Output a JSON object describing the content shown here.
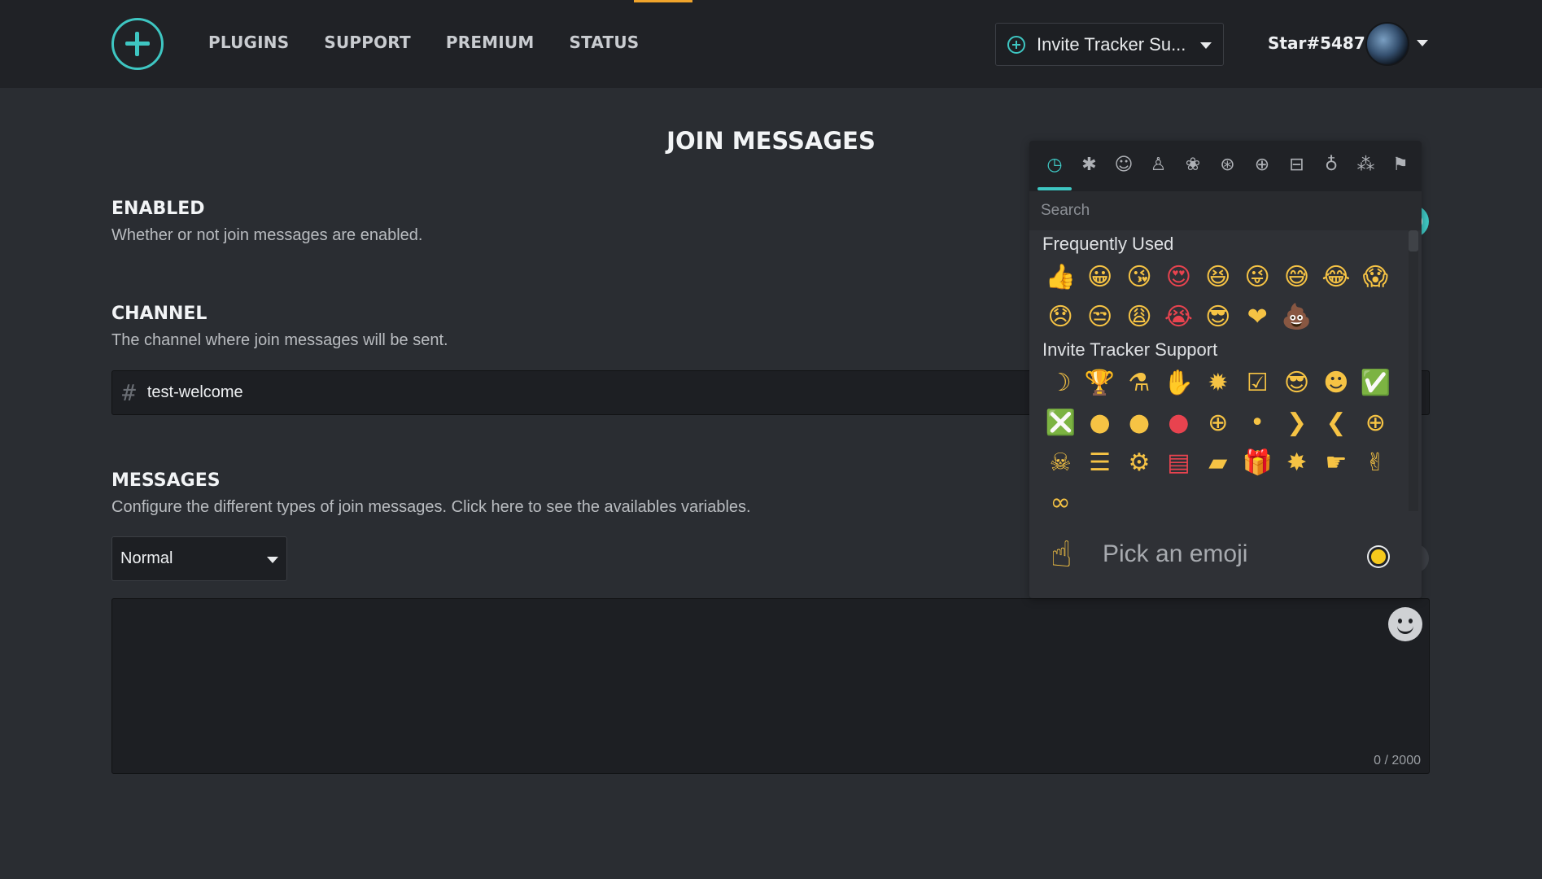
{
  "navbar": {
    "links": [
      "PLUGINS",
      "SUPPORT",
      "PREMIUM",
      "STATUS"
    ],
    "server_name": "Invite Tracker Su...",
    "user_name": "Star#5487",
    "accent_color": "#3ec6c2",
    "highlight_color": "#f0a42b"
  },
  "page": {
    "title": "JOIN MESSAGES"
  },
  "enabled": {
    "title": "ENABLED",
    "description": "Whether or not join messages are enabled."
  },
  "channel": {
    "title": "CHANNEL",
    "description": "The channel where join messages will be sent.",
    "hash": "#",
    "value": "test-welcome"
  },
  "messages": {
    "title": "MESSAGES",
    "description": "Configure the different types of join messages. Click here to see the availables variables.",
    "type_selected": "Normal",
    "char_count": "0 / 2000"
  },
  "emoji_picker": {
    "tabs": [
      {
        "name": "recent-icon",
        "glyph": "◷"
      },
      {
        "name": "custom-icon",
        "glyph": "✱"
      },
      {
        "name": "smileys-icon",
        "glyph": "☺"
      },
      {
        "name": "people-icon",
        "glyph": "♙"
      },
      {
        "name": "nature-icon",
        "glyph": "❀"
      },
      {
        "name": "food-icon",
        "glyph": "⊛"
      },
      {
        "name": "activity-icon",
        "glyph": "⊕"
      },
      {
        "name": "travel-icon",
        "glyph": "⊟"
      },
      {
        "name": "objects-icon",
        "glyph": "♁"
      },
      {
        "name": "symbols-icon",
        "glyph": "⁂"
      },
      {
        "name": "flags-icon",
        "glyph": "⚑"
      }
    ],
    "search_placeholder": "Search",
    "categories": [
      {
        "label": "Frequently Used",
        "rows": [
          [
            "👍",
            "😀",
            "😘",
            "😍",
            "😆",
            "😜",
            "😅",
            "😂",
            "😱"
          ],
          [
            "😞",
            "😒",
            "😩",
            "😭",
            "😎",
            "❤",
            "💩"
          ]
        ]
      },
      {
        "label": "Invite Tracker Support",
        "rows": [
          [
            "☽",
            "🏆",
            "⚗",
            "✋",
            "✹",
            "☑",
            "😎",
            "☻",
            "✅"
          ],
          [
            "❎",
            "●",
            "●",
            "●",
            "⊕",
            "•",
            "❯",
            "❮",
            "⊕"
          ],
          [
            "☠",
            "☰",
            "⚙",
            "▤",
            "▰",
            "🎁",
            "✸",
            "☛",
            "✌"
          ],
          [
            "∞"
          ]
        ]
      }
    ],
    "preview_emoji": "☝",
    "preview_text": "Pick an emoji"
  }
}
